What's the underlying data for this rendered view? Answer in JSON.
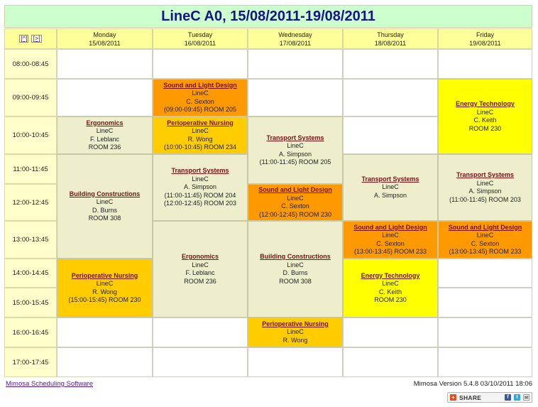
{
  "title": "LineC A0, 15/08/2011-19/08/2011",
  "nav": {
    "prev": "[^]",
    "next": "[>]"
  },
  "days": [
    {
      "name": "Monday",
      "date": "15/08/2011"
    },
    {
      "name": "Tuesday",
      "date": "16/08/2011"
    },
    {
      "name": "Wednesday",
      "date": "17/08/2011"
    },
    {
      "name": "Thursday",
      "date": "18/08/2011"
    },
    {
      "name": "Friday",
      "date": "19/08/2011"
    }
  ],
  "times": [
    "08:00-08:45",
    "09:00-09:45",
    "10:00-10:45",
    "11:00-11:45",
    "12:00-12:45",
    "13:00-13:45",
    "14:00-14:45",
    "15:00-15:45",
    "16:00-16:45",
    "17:00-17:45"
  ],
  "colors": {
    "gray": "#eeeecc",
    "orange": "#ff9900",
    "amber": "#ffcc00",
    "yellow": "#ffff00",
    "title_bg": "#ccffcc",
    "header_bg": "#ffff99"
  },
  "events": {
    "mon_ergonomics": {
      "name": "Ergonomics",
      "line": "LineC",
      "teacher": "F. Leblanc",
      "details": [
        "ROOM 236"
      ]
    },
    "mon_building": {
      "name": "Building Constructions",
      "line": "LineC",
      "teacher": "D. Burns",
      "details": [
        "ROOM 308"
      ]
    },
    "mon_periop": {
      "name": "Perioperative Nursing",
      "line": "LineC",
      "teacher": "R. Wong",
      "details": [
        "(15:00-15:45) ROOM 230"
      ]
    },
    "tue_sound": {
      "name": "Sound and Light Design",
      "line": "LineC",
      "teacher": "C. Sexton",
      "details": [
        "(09:00-09:45) ROOM 205"
      ]
    },
    "tue_periop": {
      "name": "Perioperative Nursing",
      "line": "LineC",
      "teacher": "R. Wong",
      "details": [
        "(10:00-10:45) ROOM 234"
      ]
    },
    "tue_transport": {
      "name": "Transport Systems",
      "line": "LineC",
      "teacher": "A. Simpson",
      "details": [
        "(11:00-11:45) ROOM 204",
        "(12:00-12:45) ROOM 203"
      ]
    },
    "tue_ergonomics": {
      "name": "Ergonomics",
      "line": "LineC",
      "teacher": "F. Leblanc",
      "details": [
        "ROOM 236"
      ]
    },
    "wed_transport": {
      "name": "Transport Systems",
      "line": "LineC",
      "teacher": "A. Simpson",
      "details": [
        "(11:00-11:45) ROOM 205"
      ]
    },
    "wed_sound": {
      "name": "Sound and Light Design",
      "line": "LineC",
      "teacher": "C. Sexton",
      "details": [
        "(12:00-12:45) ROOM 230"
      ]
    },
    "wed_building": {
      "name": "Building Constructions",
      "line": "LineC",
      "teacher": "D. Burns",
      "details": [
        "ROOM 308"
      ]
    },
    "wed_periop": {
      "name": "Perioperative Nursing",
      "line": "LineC",
      "teacher": "R. Wong",
      "details": []
    },
    "thu_transport": {
      "name": "Transport Systems",
      "line": "LineC",
      "teacher": "A. Simpson",
      "details": []
    },
    "thu_sound": {
      "name": "Sound and Light Design",
      "line": "LineC",
      "teacher": "C. Sexton",
      "details": [
        "(13:00-13:45) ROOM 233"
      ]
    },
    "thu_energy": {
      "name": "Energy Technology",
      "line": "LineC",
      "teacher": "C. Keith",
      "details": [
        "ROOM 230"
      ]
    },
    "fri_energy": {
      "name": "Energy Technology",
      "line": "LineC",
      "teacher": "C. Keith",
      "details": [
        "ROOM 230"
      ]
    },
    "fri_transport": {
      "name": "Transport Systems",
      "line": "LineC",
      "teacher": "A. Simpson",
      "details": [
        "(11:00-11:45) ROOM 203"
      ]
    },
    "fri_sound": {
      "name": "Sound and Light Design",
      "line": "LineC",
      "teacher": "C. Sexton",
      "details": [
        "(13:00-13:45) ROOM 233"
      ]
    }
  },
  "footer": {
    "link": "Mimosa Scheduling Software",
    "version": "Mimosa Version 5.4.8 03/10/2011 18:06",
    "share": "SHARE"
  }
}
